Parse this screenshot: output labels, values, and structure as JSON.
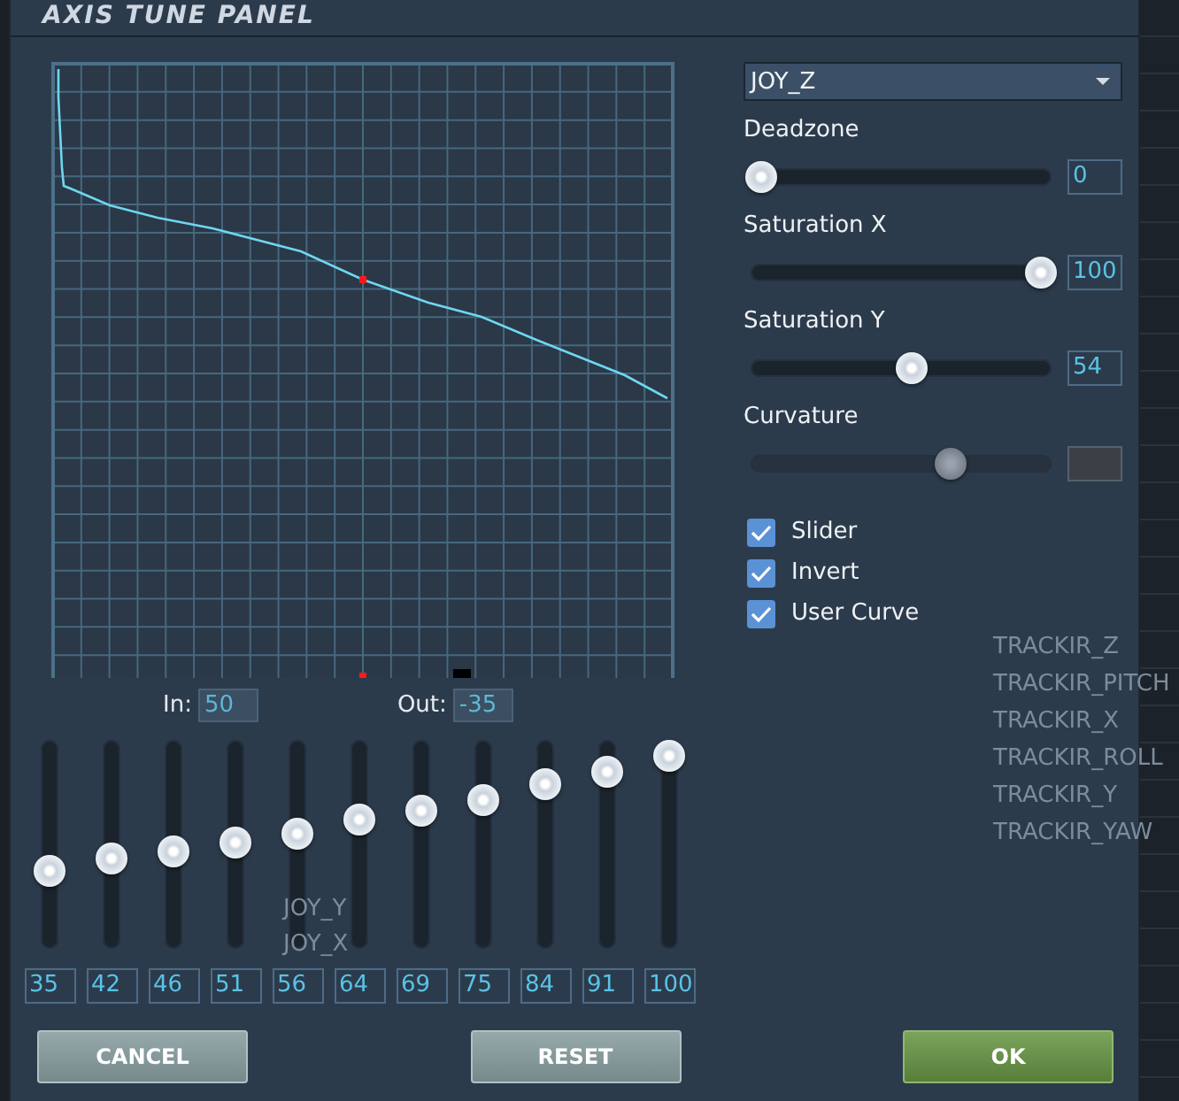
{
  "window": {
    "title": "AXIS TUNE PANEL"
  },
  "axis_select": {
    "value": "JOY_Z"
  },
  "settings": [
    {
      "label": "Deadzone",
      "level": 0,
      "value": "0",
      "disabled": false
    },
    {
      "label": "Saturation X",
      "level": 1,
      "value": "100",
      "disabled": false
    },
    {
      "label": "Saturation Y",
      "level": 0.54,
      "value": "54",
      "disabled": false
    },
    {
      "label": "Curvature",
      "level": 0.68,
      "disabled": true
    }
  ],
  "options": [
    {
      "label": "Slider",
      "checked": true
    },
    {
      "label": "Invert",
      "checked": true
    },
    {
      "label": "User Curve",
      "checked": true
    }
  ],
  "readouts": [
    {
      "label": "In:",
      "value": "50"
    },
    {
      "label": "Out:",
      "value": "-35"
    }
  ],
  "curve_points": [
    {
      "level": 0.35,
      "value": "35"
    },
    {
      "level": 0.42,
      "value": "42"
    },
    {
      "level": 0.46,
      "value": "46"
    },
    {
      "level": 0.51,
      "value": "51"
    },
    {
      "level": 0.56,
      "value": "56"
    },
    {
      "level": 0.64,
      "value": "64"
    },
    {
      "level": 0.69,
      "value": "69"
    },
    {
      "level": 0.75,
      "value": "75"
    },
    {
      "level": 0.84,
      "value": "84"
    },
    {
      "level": 0.91,
      "value": "91"
    },
    {
      "level": 1,
      "value": "100"
    }
  ],
  "background_labels": [
    "TRACKIR_Z",
    "TRACKIR_PITCH",
    "TRACKIR_X",
    "TRACKIR_ROLL",
    "TRACKIR_Y",
    "TRACKIR_YAW",
    "JOY_Y",
    "JOY_X"
  ],
  "buttons": [
    {
      "label": "CANCEL",
      "kind": "secondary"
    },
    {
      "label": "RESET",
      "kind": "secondary"
    },
    {
      "label": "OK",
      "kind": "primary"
    }
  ]
}
